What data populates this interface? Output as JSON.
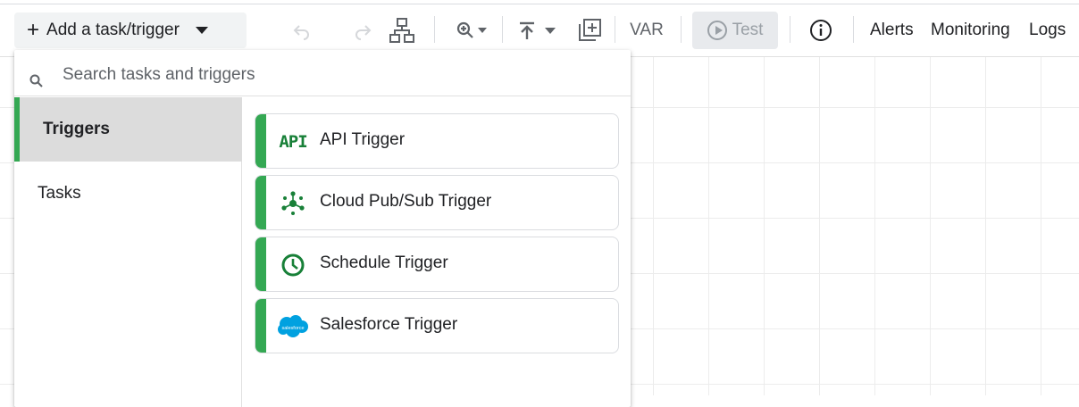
{
  "toolbar": {
    "add_label": "Add a task/trigger",
    "var_label": "VAR",
    "test_label": "Test",
    "alerts_label": "Alerts",
    "monitoring_label": "Monitoring",
    "logs_label": "Logs"
  },
  "panel": {
    "search_placeholder": "Search tasks and triggers",
    "categories": [
      {
        "label": "Triggers",
        "active": true
      },
      {
        "label": "Tasks",
        "active": false
      }
    ],
    "items": [
      {
        "label": "API Trigger",
        "icon": "api-icon"
      },
      {
        "label": "Cloud Pub/Sub Trigger",
        "icon": "pubsub-icon"
      },
      {
        "label": "Schedule Trigger",
        "icon": "clock-icon"
      },
      {
        "label": "Salesforce Trigger",
        "icon": "salesforce-icon"
      }
    ],
    "api_icon_text": "API",
    "salesforce_icon_text": "salesforce"
  },
  "colors": {
    "accent_green": "#34a853",
    "icon_green": "#188038",
    "salesforce_blue": "#00a1e0"
  }
}
